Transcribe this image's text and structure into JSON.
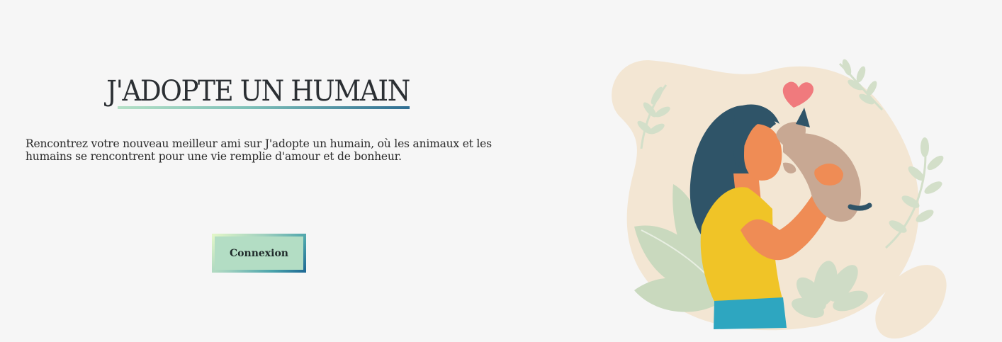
{
  "hero": {
    "title": "J'ADOPTE UN HUMAIN",
    "description": "Rencontrez votre nouveau meilleur ami sur J'adopte un humain, où les animaux et les humains se rencontrent pour une vie remplie d'amour et de bonheur.",
    "login_button": "Connexion"
  },
  "colors": {
    "background": "#f6f6f6",
    "title_text": "#2b2f33",
    "button_fill": "#b3ddc4",
    "accent_dark": "#2f6e93",
    "accent_light": "#b4e0c6"
  },
  "illustration": {
    "icon": "woman-hugging-cat-illustration"
  }
}
